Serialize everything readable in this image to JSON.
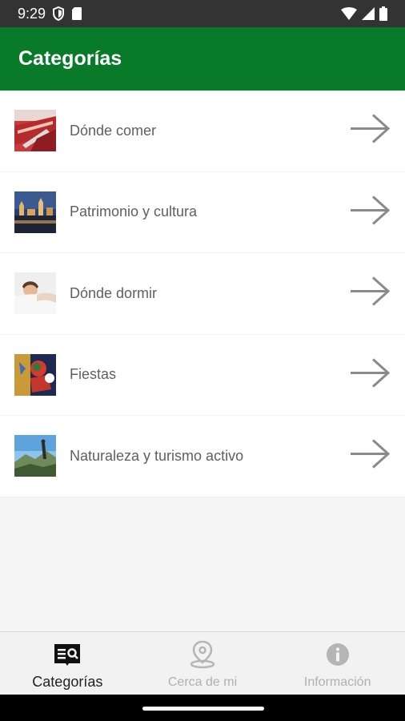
{
  "status_bar": {
    "time": "9:29",
    "icons": [
      "shield-icon",
      "sim-card-icon",
      "wifi-icon",
      "signal-icon",
      "battery-icon"
    ]
  },
  "app_bar": {
    "title": "Categorías",
    "background": "#087a2a"
  },
  "categories": [
    {
      "label": "Dónde comer",
      "thumbnail": "ham-photo"
    },
    {
      "label": "Patrimonio y cultura",
      "thumbnail": "city-night-photo"
    },
    {
      "label": "Dónde dormir",
      "thumbnail": "sleeping-photo"
    },
    {
      "label": "Fiestas",
      "thumbnail": "festival-photo"
    },
    {
      "label": "Naturaleza y turismo activo",
      "thumbnail": "nature-photo"
    }
  ],
  "bottom_nav": {
    "items": [
      {
        "label": "Categorías",
        "icon": "categories-icon",
        "active": true
      },
      {
        "label": "Cerca de mi",
        "icon": "location-pin-icon",
        "active": false
      },
      {
        "label": "Información",
        "icon": "info-icon",
        "active": false
      }
    ]
  }
}
